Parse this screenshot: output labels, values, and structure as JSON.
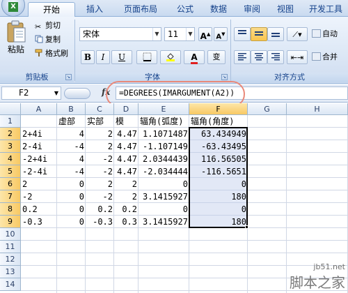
{
  "tabs": [
    "开始",
    "插入",
    "页面布局",
    "公式",
    "数据",
    "审阅",
    "视图",
    "开发工具"
  ],
  "active_tab": "开始",
  "office_logo_text": "X",
  "ribbon": {
    "clipboard": {
      "paste_label": "粘贴",
      "cut_label": "剪切",
      "copy_label": "复制",
      "format_painter_label": "格式刷",
      "group_label": "剪贴板"
    },
    "font": {
      "font_name": "宋体",
      "font_size": "11",
      "bold": "B",
      "italic": "I",
      "underline": "U",
      "grow": "A",
      "shrink": "A",
      "font_color_letter": "A",
      "change_case": "变",
      "group_label": "字体"
    },
    "alignment": {
      "wrap_label": "自动",
      "merge_label": "合并",
      "group_label": "对齐方式"
    }
  },
  "formula_bar": {
    "name_box": "F2",
    "fx": "fx",
    "formula": "=DEGREES(IMARGUMENT(A2))"
  },
  "columns": [
    "A",
    "B",
    "C",
    "D",
    "E",
    "F",
    "G",
    "H"
  ],
  "rows": [
    "1",
    "2",
    "3",
    "4",
    "5",
    "6",
    "7",
    "8",
    "9",
    "10",
    "11",
    "12",
    "13",
    "14"
  ],
  "sheet": {
    "header_row": [
      "",
      "虚部",
      "实部",
      "模",
      "辐角(弧度)",
      "辐角(角度)"
    ],
    "data": [
      [
        "2+4i",
        "4",
        "2",
        "4.47",
        "1.1071487",
        "63.434949"
      ],
      [
        "2-4i",
        "-4",
        "2",
        "4.47",
        "-1.107149",
        "-63.43495"
      ],
      [
        "-2+4i",
        "4",
        "-2",
        "4.47",
        "2.0344439",
        "116.56505"
      ],
      [
        "-2-4i",
        "-4",
        "-2",
        "4.47",
        "-2.034444",
        "-116.5651"
      ],
      [
        "2",
        "0",
        "2",
        "2",
        "0",
        "0"
      ],
      [
        "-2",
        "0",
        "-2",
        "2",
        "3.1415927",
        "180"
      ],
      [
        "0.2",
        "0",
        "0.2",
        "0.2",
        "0",
        "0"
      ],
      [
        "-0.3",
        "0",
        "-0.3",
        "0.3",
        "3.1415927",
        "180"
      ]
    ]
  },
  "selected_column": "F",
  "watermark": {
    "site": "jb51.net",
    "name": "脚本之家"
  },
  "colors": {
    "accent": "#15428b",
    "highlight_oval": "#e9897a",
    "selection_header": "#f8c964"
  }
}
